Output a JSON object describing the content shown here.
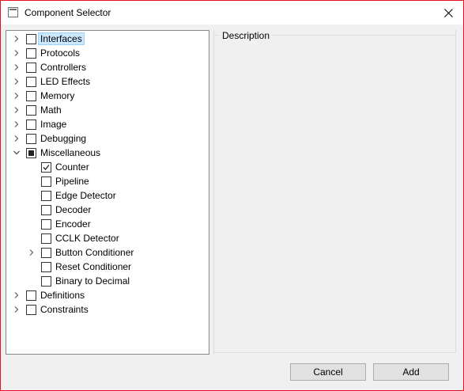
{
  "window": {
    "title": "Component Selector"
  },
  "tree": {
    "items": [
      {
        "label": "Interfaces",
        "level": 0,
        "expander": "collapsed",
        "checked": "unchecked",
        "selected": true
      },
      {
        "label": "Protocols",
        "level": 0,
        "expander": "collapsed",
        "checked": "unchecked"
      },
      {
        "label": "Controllers",
        "level": 0,
        "expander": "collapsed",
        "checked": "unchecked"
      },
      {
        "label": "LED Effects",
        "level": 0,
        "expander": "collapsed",
        "checked": "unchecked"
      },
      {
        "label": "Memory",
        "level": 0,
        "expander": "collapsed",
        "checked": "unchecked"
      },
      {
        "label": "Math",
        "level": 0,
        "expander": "collapsed",
        "checked": "unchecked"
      },
      {
        "label": "Image",
        "level": 0,
        "expander": "collapsed",
        "checked": "unchecked"
      },
      {
        "label": "Debugging",
        "level": 0,
        "expander": "collapsed",
        "checked": "unchecked"
      },
      {
        "label": "Miscellaneous",
        "level": 0,
        "expander": "expanded",
        "checked": "indeterminate"
      },
      {
        "label": "Counter",
        "level": 1,
        "expander": "none",
        "checked": "checked"
      },
      {
        "label": "Pipeline",
        "level": 1,
        "expander": "none",
        "checked": "unchecked"
      },
      {
        "label": "Edge Detector",
        "level": 1,
        "expander": "none",
        "checked": "unchecked"
      },
      {
        "label": "Decoder",
        "level": 1,
        "expander": "none",
        "checked": "unchecked"
      },
      {
        "label": "Encoder",
        "level": 1,
        "expander": "none",
        "checked": "unchecked"
      },
      {
        "label": "CCLK Detector",
        "level": 1,
        "expander": "none",
        "checked": "unchecked"
      },
      {
        "label": "Button Conditioner",
        "level": 1,
        "expander": "collapsed",
        "checked": "unchecked"
      },
      {
        "label": "Reset Conditioner",
        "level": 1,
        "expander": "none",
        "checked": "unchecked"
      },
      {
        "label": "Binary to Decimal",
        "level": 1,
        "expander": "none",
        "checked": "unchecked"
      },
      {
        "label": "Definitions",
        "level": 0,
        "expander": "collapsed",
        "checked": "unchecked"
      },
      {
        "label": "Constraints",
        "level": 0,
        "expander": "collapsed",
        "checked": "unchecked"
      }
    ]
  },
  "description": {
    "label": "Description"
  },
  "buttons": {
    "cancel": "Cancel",
    "add": "Add"
  },
  "colors": {
    "selection_bg": "#cce8ff",
    "selection_border": "#99d1ff",
    "window_border": "#e81123"
  }
}
